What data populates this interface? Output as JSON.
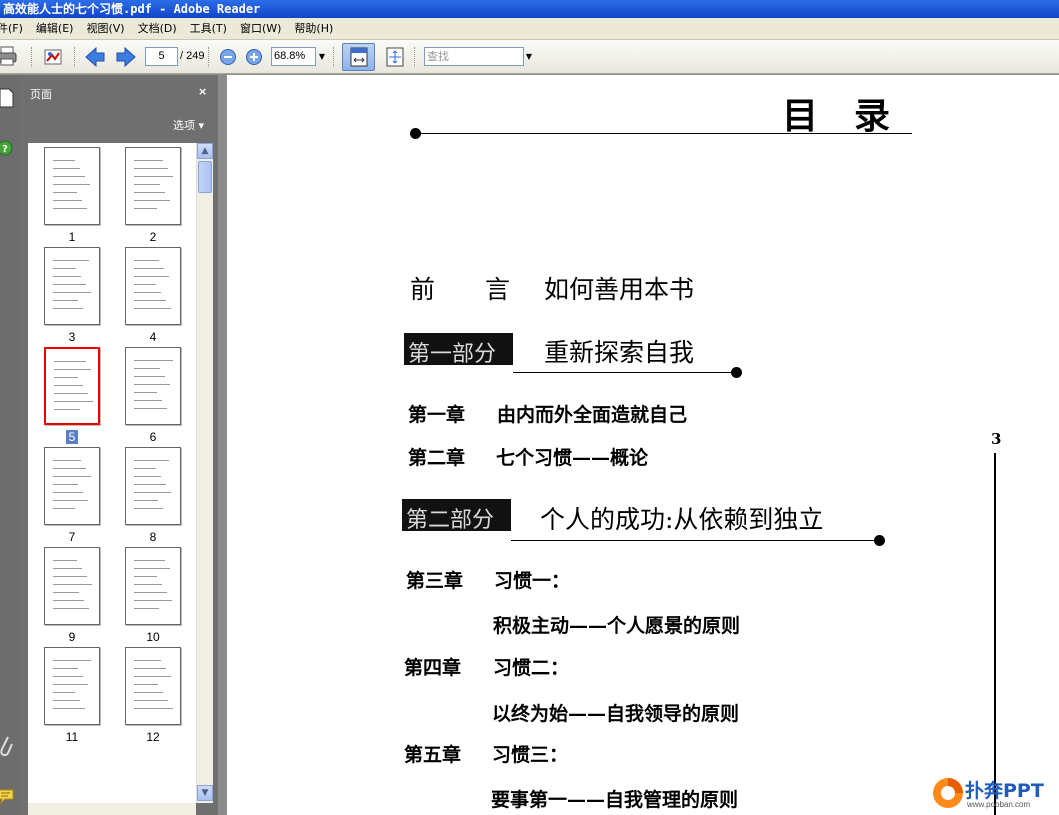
{
  "window": {
    "title": "高效能人士的七个习惯.pdf - Adobe Reader"
  },
  "menu": {
    "items": [
      "件(F)",
      "编辑(E)",
      "视图(V)",
      "文档(D)",
      "工具(T)",
      "窗口(W)",
      "帮助(H)"
    ]
  },
  "toolbar": {
    "current_page": "5",
    "total_pages": "/ 249",
    "zoom": "68.8%",
    "search_placeholder": "查找"
  },
  "nav_panel": {
    "title": "页面",
    "close": "×",
    "options": "选项 ▾"
  },
  "thumbnails": [
    {
      "label": "1"
    },
    {
      "label": "2"
    },
    {
      "label": "3"
    },
    {
      "label": "4"
    },
    {
      "label": "5",
      "selected": true
    },
    {
      "label": "6"
    },
    {
      "label": "7"
    },
    {
      "label": "8"
    },
    {
      "label": "9"
    },
    {
      "label": "10"
    },
    {
      "label": "11"
    },
    {
      "label": "12"
    }
  ],
  "document": {
    "heading": "目　录",
    "preface": {
      "label": "前　　言",
      "text": "如何善用本书"
    },
    "part1": {
      "label": "第一部分",
      "title": "重新探索自我"
    },
    "ch1": {
      "label": "第一章",
      "title": "由内而外全面造就自己"
    },
    "ch2": {
      "label": "第二章",
      "title": "七个习惯——概论"
    },
    "part2": {
      "label": "第二部分",
      "title": "个人的成功:从依赖到独立"
    },
    "ch3": {
      "label": "第三章",
      "title": "习惯一：",
      "subtitle": "积极主动——个人愿景的原则"
    },
    "ch4": {
      "label": "第四章",
      "title": "习惯二：",
      "subtitle": "以终为始——自我领导的原则"
    },
    "ch5": {
      "label": "第五章",
      "title": "习惯三：",
      "subtitle": "要事第一——自我管理的原则"
    },
    "page_number": "3"
  },
  "watermark": {
    "brand": "扑奔PPT",
    "url": "www.pooban.com"
  }
}
